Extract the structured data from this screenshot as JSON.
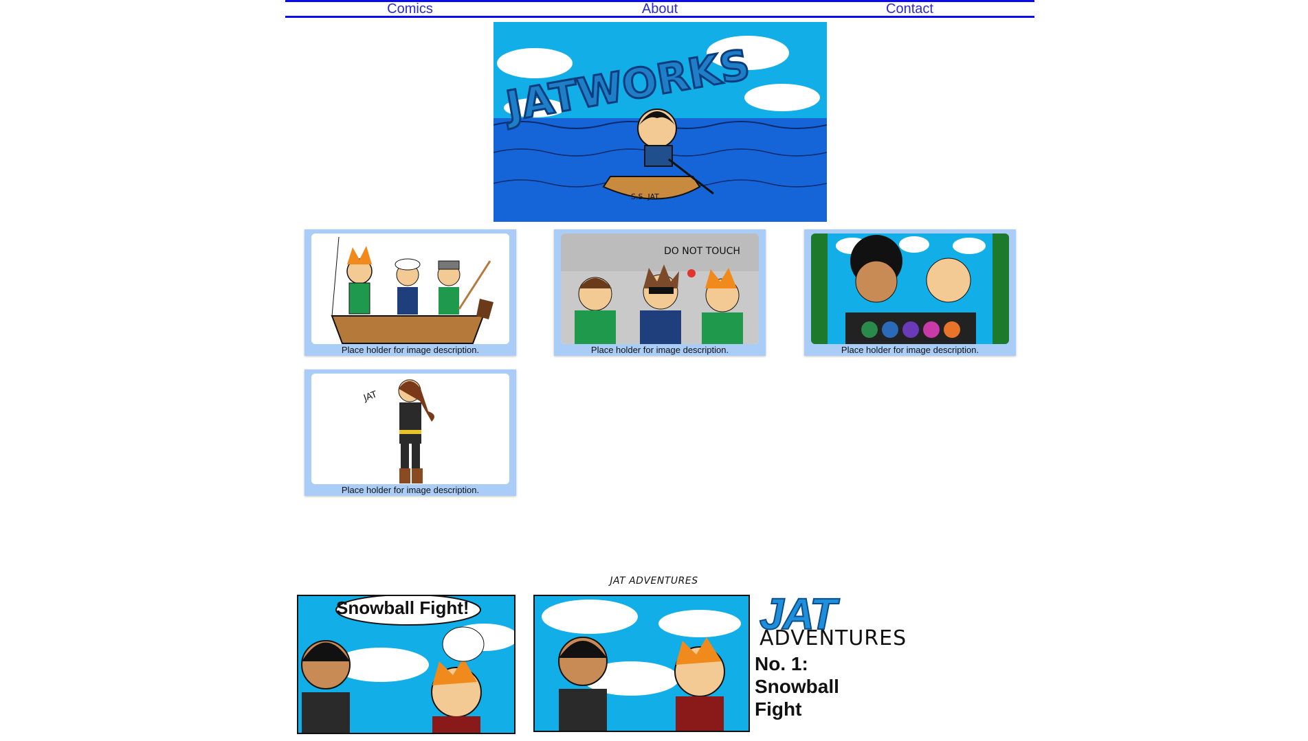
{
  "nav": {
    "items": [
      {
        "label": "Comics"
      },
      {
        "label": "About"
      },
      {
        "label": "Contact"
      }
    ]
  },
  "banner": {
    "logo_text": "JATWORKS",
    "boat_text": "S.S. JAT"
  },
  "thumbnails": [
    {
      "caption": "Place holder for image description.",
      "icon": "fishing-boat-scene"
    },
    {
      "caption": "Place holder for image description.",
      "icon": "do-not-touch-scene",
      "sign_text": "DO NOT TOUCH"
    },
    {
      "caption": "Place holder for image description.",
      "icon": "two-friends-scene"
    },
    {
      "caption": "Place holder for image description.",
      "icon": "standing-character-scene"
    }
  ],
  "strip": {
    "title": "JAT ADVENTURES",
    "bubble": "Snowball Fight!",
    "logo": "JAT",
    "logo_sub": "ADVENTURES",
    "episode_line1": "No. 1:",
    "episode_line2": "Snowball",
    "episode_line3": "Fight"
  },
  "colors": {
    "nav_border": "#0b0bf0",
    "nav_link": "#2a2ad8",
    "card_bg": "#a9cdf6",
    "sky": "#12aee8",
    "sea": "#1565d8"
  }
}
